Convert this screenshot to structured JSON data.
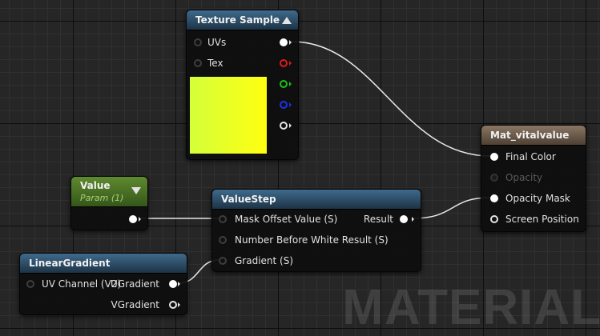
{
  "watermark": "MATERIAL",
  "nodes": {
    "texture_sample": {
      "title": "Texture Sample",
      "inputs": [
        "UVs",
        "Tex"
      ],
      "preview_color": "#e6ff2a"
    },
    "mat_vitalvalue": {
      "title": "Mat_vitalvalue",
      "inputs": [
        "Final Color",
        "Opacity",
        "Opacity Mask",
        "Screen Position"
      ]
    },
    "value": {
      "title": "Value",
      "subtitle": "Param (1)"
    },
    "value_step": {
      "title": "ValueStep",
      "inputs": [
        "Mask Offset Value (S)",
        "Number Before White Result (S)",
        "Gradient (S)"
      ],
      "outputs": [
        "Result"
      ]
    },
    "linear_gradient": {
      "title": "LinearGradient",
      "inputs": [
        "UV Channel (V2)"
      ],
      "outputs": [
        "UGradient",
        "VGradient"
      ]
    }
  },
  "colors": {
    "header_blue": "#2a4b66",
    "header_green": "#4c7a25",
    "header_brown": "#6e5b4c",
    "pin_red": "#e01a1a",
    "pin_green": "#19c219",
    "pin_blue": "#1b33e8"
  }
}
